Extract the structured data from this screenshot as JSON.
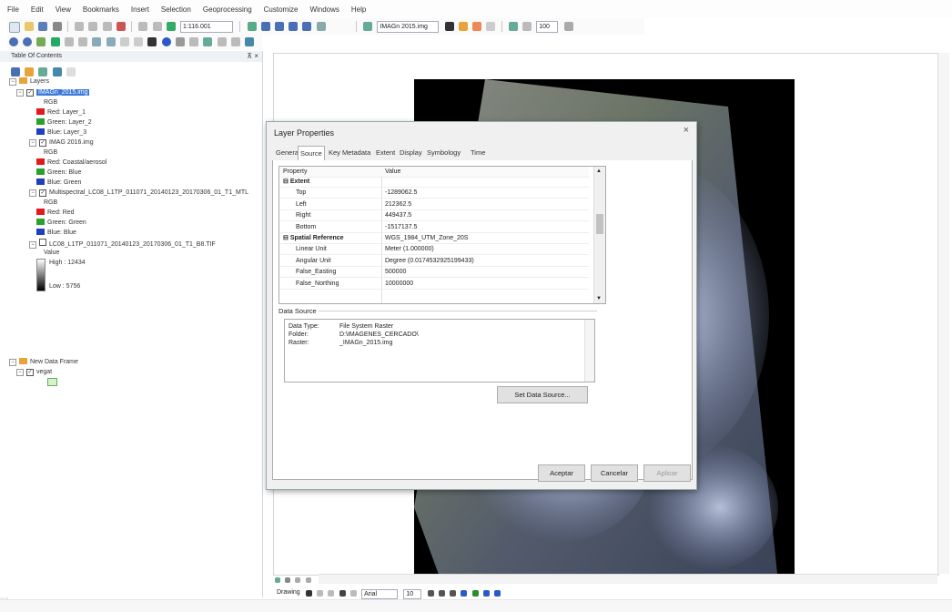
{
  "menu": [
    "File",
    "Edit",
    "View",
    "Bookmarks",
    "Insert",
    "Selection",
    "Geoprocessing",
    "Customize",
    "Windows",
    "Help"
  ],
  "toolbar": {
    "scale": "1:116.001",
    "layer_combo": "IMAGn 2015.img",
    "zoom_value": "100"
  },
  "toc": {
    "title": "Table Of Contents",
    "root": "Layers",
    "layers": [
      {
        "name": "IMAGn_2015.img",
        "selected": true,
        "sub": "RGB",
        "bands": [
          {
            "label": "Red:  Layer_1",
            "color": "#e31a1c"
          },
          {
            "label": "Green: Layer_2",
            "color": "#2ca02c"
          },
          {
            "label": "Blue:  Layer_3",
            "color": "#1f3fbf"
          }
        ]
      },
      {
        "name": "IMAG 2016.img",
        "sub": "RGB",
        "bands": [
          {
            "label": "Red:  Coastal/aerosol",
            "color": "#e31a1c"
          },
          {
            "label": "Green: Blue",
            "color": "#2ca02c"
          },
          {
            "label": "Blue:  Green",
            "color": "#1f3fbf"
          }
        ]
      },
      {
        "name": "Multispectral_LC08_L1TP_011071_20140123_20170306_01_T1_MTL",
        "sub": "RGB",
        "bands": [
          {
            "label": "Red:  Red",
            "color": "#e31a1c"
          },
          {
            "label": "Green: Green",
            "color": "#2ca02c"
          },
          {
            "label": "Blue:  Blue",
            "color": "#1f3fbf"
          }
        ]
      },
      {
        "name": "LC08_L1TP_011071_20140123_20170306_01_T1_B8.TIF",
        "value_label": "Value",
        "high": "High : 12434",
        "low": "Low : 5756"
      }
    ],
    "frame2": "New Data Frame",
    "frame2_layer": "vegat"
  },
  "dialog": {
    "title": "Layer Properties",
    "close": "×",
    "tabs": [
      "General",
      "Source",
      "Key Metadata",
      "Extent",
      "Display",
      "Symbology",
      "Time"
    ],
    "active_tab": "Source",
    "table": {
      "headers": [
        "Property",
        "Value"
      ],
      "rows": [
        {
          "p": "Extent",
          "v": "",
          "group": true
        },
        {
          "p": "Top",
          "v": "-1289062.5"
        },
        {
          "p": "Left",
          "v": "212362.5"
        },
        {
          "p": "Right",
          "v": "449437.5"
        },
        {
          "p": "Bottom",
          "v": "-1517137.5"
        },
        {
          "p": "Spatial Reference",
          "v": "WGS_1984_UTM_Zone_20S",
          "group": true
        },
        {
          "p": "Linear Unit",
          "v": "Meter (1.000000)"
        },
        {
          "p": "Angular Unit",
          "v": "Degree (0.0174532925199433)"
        },
        {
          "p": "False_Easting",
          "v": "500000"
        },
        {
          "p": "False_Northing",
          "v": "10000000"
        }
      ]
    },
    "data_source": {
      "label": "Data Source",
      "rows": [
        {
          "k": "Data Type:",
          "v": "File System Raster"
        },
        {
          "k": "Folder:",
          "v": "D:\\IMAGENES_CERCADO\\"
        },
        {
          "k": "Raster:",
          "v": "_IMAGn_2015.img"
        }
      ]
    },
    "set_source_button": "Set Data Source...",
    "ok_button": "Aceptar",
    "cancel_button": "Cancelar",
    "apply_button": "Aplicar"
  },
  "drawbar": {
    "drawing": "Drawing",
    "font": "Arial",
    "size": "10"
  },
  "status": {
    "coords": ""
  }
}
